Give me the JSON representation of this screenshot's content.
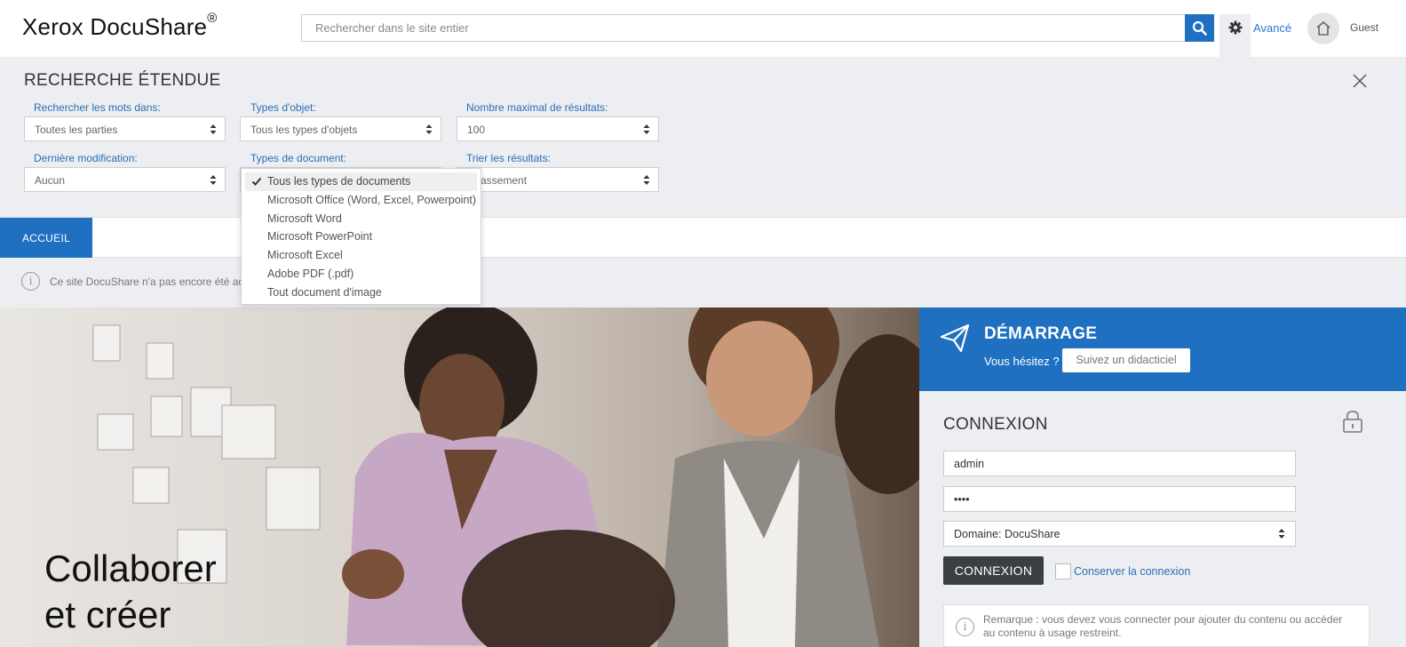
{
  "header": {
    "logo": "Xerox DocuShare",
    "logo_mark": "®",
    "search_placeholder": "Rechercher dans le site entier",
    "advanced_label": "Avancé",
    "user_label": "Guest"
  },
  "advanced_search": {
    "title": "RECHERCHE ÉTENDUE",
    "fields": {
      "search_words_in": {
        "label": "Rechercher les mots dans:",
        "value": "Toutes les parties"
      },
      "object_types": {
        "label": "Types d'objet:",
        "value": "Tous les types d'objets"
      },
      "max_results": {
        "label": "Nombre maximal de résultats:",
        "value": "100"
      },
      "last_modified": {
        "label": "Dernière modification:",
        "value": "Aucun"
      },
      "document_types": {
        "label": "Types de document:"
      },
      "sort_results": {
        "label": "Trier les résultats:",
        "value": "assement"
      }
    },
    "document_type_options": [
      "Tous les types de documents",
      "Microsoft Office (Word, Excel, Powerpoint)",
      "Microsoft Word",
      "Microsoft PowerPoint",
      "Microsoft Excel",
      "Adobe PDF (.pdf)",
      "Tout document d'image"
    ],
    "document_type_selected": "Tous les types de documents"
  },
  "tabs": {
    "home": "ACCUEIL"
  },
  "notice": {
    "text": "Ce site DocuShare n'a pas encore été activ"
  },
  "hero": {
    "line1": "Collaborer",
    "line2": "et créer"
  },
  "getting_started": {
    "title": "DÉMARRAGE",
    "question": "Vous hésitez ?",
    "tutorial_button": "Suivez un didacticiel"
  },
  "login": {
    "title": "CONNEXION",
    "username": "admin",
    "password": "••••",
    "domain": "Domaine: DocuShare",
    "submit_label": "CONNEXION",
    "remember_label": "Conserver la connexion",
    "remark": "Remarque : vous devez vous connecter pour ajouter du contenu ou accéder au contenu à usage restreint."
  },
  "colors": {
    "accent": "#1f70c1",
    "panel": "#eceef1",
    "link": "#2a6fb6",
    "button_dark": "#3a3f44"
  },
  "icons": {
    "search": "search-icon",
    "settings": "gear-icon",
    "home": "home-icon",
    "close": "close-icon",
    "info": "info-icon",
    "send": "paper-plane-icon",
    "lock": "lock-icon",
    "check": "check-icon"
  }
}
